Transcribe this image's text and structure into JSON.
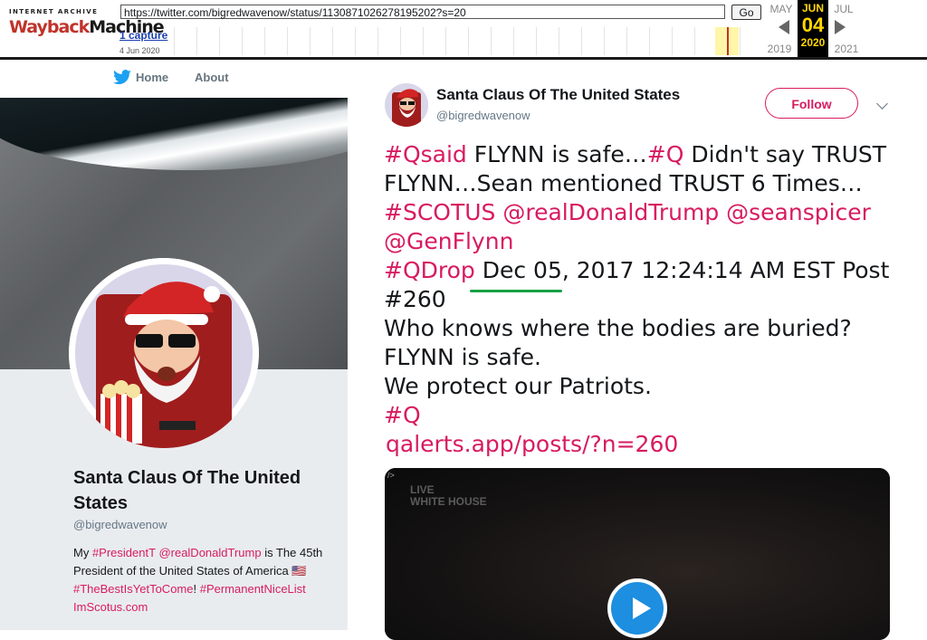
{
  "wayback": {
    "logo_top": "INTERNET ARCHIVE",
    "logo_main": "Wayback",
    "logo_main2": "Machine",
    "url": "https://twitter.com/bigredwavenow/status/1130871026278195202?s=20",
    "go_label": "Go",
    "captures": "1 capture",
    "capture_date": "4 Jun 2020",
    "prev_month": "MAY",
    "cur_month": "JUN",
    "next_month": "JUL",
    "cur_day": "04",
    "prev_year": "2019",
    "cur_year": "2020",
    "next_year": "2021"
  },
  "nav": {
    "home": "Home",
    "about": "About"
  },
  "profile": {
    "name": "Santa Claus Of The United States",
    "handle": "@bigredwavenow",
    "bio_parts": [
      "My ",
      "#PresidentT",
      " ",
      "@realDonaldTrump",
      " is The 45th President of the United States of America ",
      "🇺🇸",
      " ",
      "#TheBestIsYetToCome",
      "! ",
      "#PermanentNiceList",
      " ",
      "ImScotus.com"
    ]
  },
  "tweet": {
    "name": "Santa Claus Of The United States",
    "handle": "@bigredwavenow",
    "follow_label": "Follow",
    "line1_tag": "#Qsaid",
    "line1_text": " FLYNN is safe…",
    "line1_tag2": "#Q",
    "line1_text2": " Didn't say TRUST FLYNN…Sean mentioned TRUST 6 Times…",
    "tag_scotus": "#SCOTUS",
    "mention_trump": "@realDonaldTrump",
    "mention_spicer": "@seanspicer",
    "mention_flynn": "@GenFlynn",
    "tag_qdrop": "#QDrop",
    "date_text": "Dec 05",
    "post_text": ", 2017 12:24:14 AM EST Post #260",
    "line_bodies": "Who knows where the bodies are buried?",
    "line_flynn": "FLYNN is safe.",
    "line_patriots": "We protect our Patriots.",
    "tag_q_end": "#Q",
    "link": "qalerts.app/posts/?n=260"
  },
  "media": {
    "corner": "/>",
    "live_1": "LIVE",
    "live_2": "WHITE HOUSE"
  },
  "colors": {
    "accent": "#d81b60",
    "play": "#1d8ee0",
    "twitter_blue": "#1da1f2"
  }
}
